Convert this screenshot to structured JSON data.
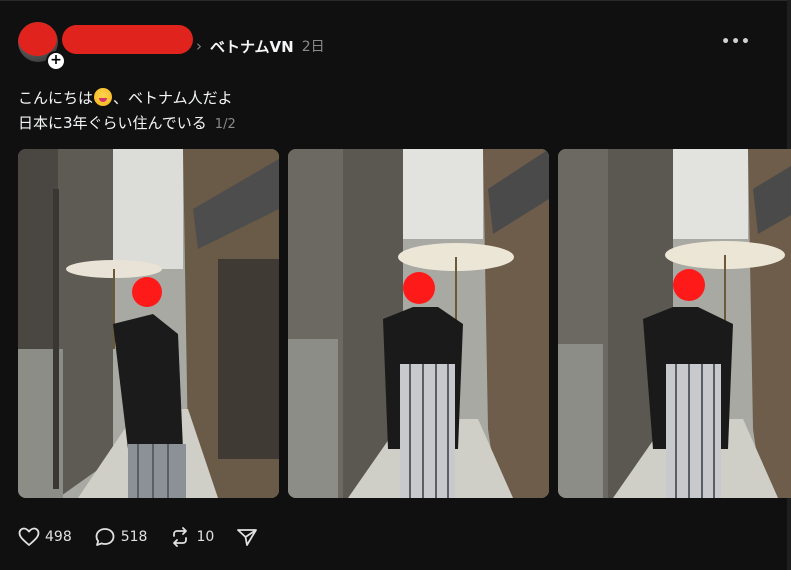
{
  "post": {
    "community": "ベトナムVN",
    "time": "2日",
    "text_line1_before": "こんにちは",
    "text_line1_after": "、ベトナム人だよ",
    "text_line2": "日本に3年ぐらい住んでいる",
    "page_count": "1/2"
  },
  "icons": {
    "more": "more-horizontal-icon",
    "like": "heart-icon",
    "reply": "comment-icon",
    "repost": "repost-icon",
    "share": "send-icon",
    "emoji": "grinning-face-emoji"
  },
  "photos": [
    {
      "label": "kimono-photo-1"
    },
    {
      "label": "kimono-photo-2"
    },
    {
      "label": "kimono-photo-3"
    }
  ],
  "actions": {
    "likes": "498",
    "replies": "518",
    "reposts": "10"
  },
  "colors": {
    "background": "#101010",
    "text": "#f3f5f7",
    "muted": "#8a8a8a",
    "redaction": "#e0241d"
  }
}
